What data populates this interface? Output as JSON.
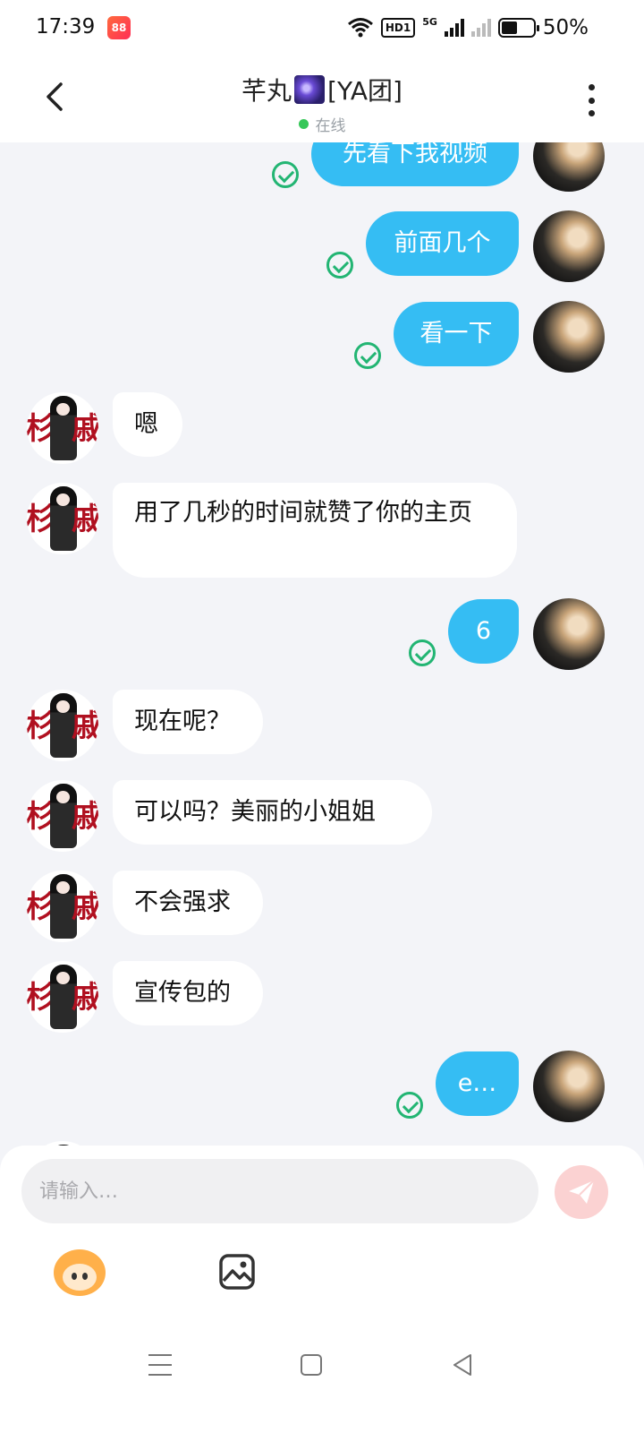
{
  "status_bar": {
    "time": "17:39",
    "app_badge": "88",
    "hd": "HD1",
    "net": "5G",
    "battery": "50%"
  },
  "header": {
    "name_prefix": "芊丸",
    "name_suffix": "[YA团]",
    "status": "在线"
  },
  "messages": [
    {
      "side": "out",
      "text": "先看下我视频"
    },
    {
      "side": "out",
      "text": "前面几个"
    },
    {
      "side": "out",
      "text": "看一下"
    },
    {
      "side": "in",
      "text": "嗯"
    },
    {
      "side": "in",
      "text": "用了几秒的时间就赞了你的主页"
    },
    {
      "side": "out",
      "text": "6"
    },
    {
      "side": "in",
      "text": "现在呢？"
    },
    {
      "side": "in",
      "text": "可以吗？美丽的小姐姐"
    },
    {
      "side": "in",
      "text": "不会强求"
    },
    {
      "side": "in",
      "text": "宣传包的"
    },
    {
      "side": "out",
      "text": "e…"
    }
  ],
  "input": {
    "placeholder": "请输入…"
  },
  "icons": {
    "back": "back-arrow-icon",
    "more": "more-vertical-icon",
    "send": "send-icon",
    "emoji": "emoji-icon",
    "image": "image-icon"
  },
  "colors": {
    "outgoing_bubble": "#35bdf3",
    "incoming_bubble": "#ffffff",
    "chat_background": "#f3f4f8",
    "read_check": "#22b573",
    "online_dot": "#35c758"
  }
}
